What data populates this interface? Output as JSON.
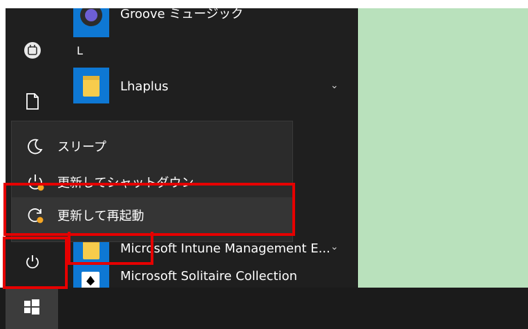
{
  "start_menu": {
    "apps": [
      {
        "label": "Groove ミュージック"
      },
      {
        "label": "Lhaplus"
      },
      {
        "label": "Microsoft Intune Management E..."
      },
      {
        "label": "Microsoft Solitaire Collection"
      }
    ],
    "section_letter": "L"
  },
  "power_menu": {
    "items": [
      {
        "label": "スリープ",
        "icon": "moon-icon"
      },
      {
        "label": "更新してシャットダウン",
        "icon": "update-shutdown-icon"
      },
      {
        "label": "更新して再起動",
        "icon": "update-restart-icon"
      }
    ]
  },
  "rail": {
    "items": [
      {
        "name": "user-avatar-icon"
      },
      {
        "name": "document-icon"
      },
      {
        "name": "power-icon"
      }
    ]
  },
  "taskbar": {
    "start_icon": "windows-logo-icon"
  },
  "colors": {
    "start_bg": "#1f1f1f",
    "popup_bg": "#2b2b2b",
    "tile_blue": "#0e78d4",
    "desktop_green": "#b9e1bc",
    "highlight_red": "#e60000",
    "update_badge": "#f5a623"
  }
}
